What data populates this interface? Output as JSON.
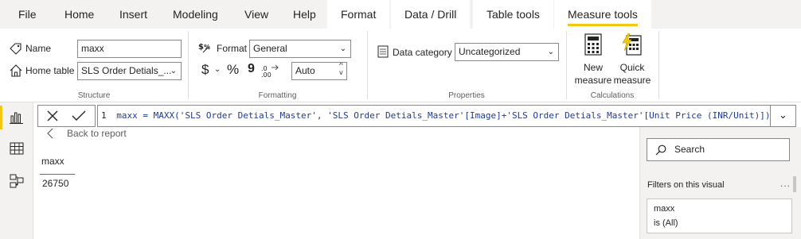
{
  "tabs": [
    "File",
    "Home",
    "Insert",
    "Modeling",
    "View",
    "Help",
    "Format",
    "Data / Drill",
    "Table tools",
    "Measure tools"
  ],
  "structure": {
    "name_label": "Name",
    "name_value": "maxx",
    "home_table_label": "Home table",
    "home_table_value": "SLS Order Detials_...",
    "group_label": "Structure"
  },
  "formatting": {
    "format_label": "Format",
    "format_value": "General",
    "currency_symbol": "$",
    "percent_symbol": "%",
    "comma_symbol": "9",
    "decimal_value": "Auto",
    "group_label": "Formatting"
  },
  "properties": {
    "data_category_label": "Data category",
    "data_category_value": "Uncategorized",
    "group_label": "Properties"
  },
  "calculations": {
    "new_measure_line1": "New",
    "new_measure_line2": "measure",
    "quick_measure_line1": "Quick",
    "quick_measure_line2": "measure",
    "group_label": "Calculations"
  },
  "formula": {
    "line_number": "1",
    "text": "maxx = MAXX('SLS Order Detials_Master', 'SLS Order Detials_Master'[Image]+'SLS Order Detials_Master'[Unit Price (INR/Unit)])"
  },
  "canvas": {
    "back_label": "Back to report",
    "card_header": "maxx",
    "card_value": "26750"
  },
  "filters": {
    "search_placeholder": "Search",
    "header": "Filters on this visual",
    "more": "...",
    "field_name": "maxx",
    "field_value": "is (All)"
  },
  "colors": {
    "accent": "#f2c811",
    "link_blue": "#2b7cd3",
    "ribbon_bg": "#f3f2f1"
  }
}
